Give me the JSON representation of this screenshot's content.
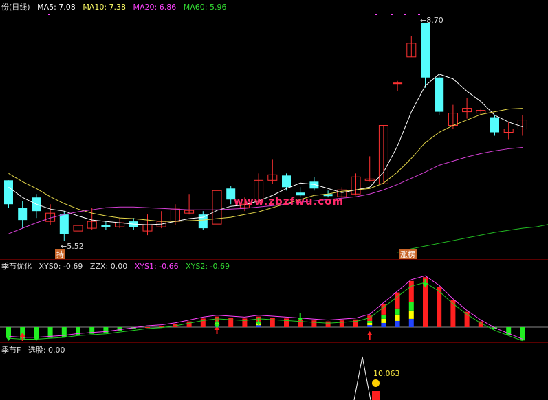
{
  "main": {
    "title_prefix": "份(日线)",
    "ma": [
      {
        "label": "MA5: 7.08",
        "color": "#ffffff"
      },
      {
        "label": "MA10: 7.38",
        "color": "#ffff66"
      },
      {
        "label": "MA20: 6.86",
        "color": "#ff44ff"
      },
      {
        "label": "MA60: 5.96",
        "color": "#33dd33"
      }
    ],
    "high_note": "8.70",
    "low_note": "5.52",
    "tag_left": "持",
    "tag_right": "涨楞",
    "watermark": "www.zbzfwu.com"
  },
  "indicator1": {
    "name": "季节优化",
    "values": [
      {
        "label": "XYS0: -0.69",
        "color": "#dddddd"
      },
      {
        "label": "ZZX: 0.00",
        "color": "#dddddd"
      },
      {
        "label": "XYS1: -0.66",
        "color": "#ff44ff"
      },
      {
        "label": "XYS2: -0.69",
        "color": "#33dd33"
      }
    ]
  },
  "indicator2": {
    "name": "季节F",
    "values": [
      {
        "label": "选股: 0.00",
        "color": "#dddddd"
      }
    ],
    "note": "10.063"
  },
  "chart_data": {
    "type": "candlestick",
    "candles": [
      {
        "o": 6.4,
        "c": 6.05,
        "h": 6.4,
        "l": 6.0
      },
      {
        "o": 6.0,
        "c": 5.82,
        "h": 6.1,
        "l": 5.7
      },
      {
        "o": 6.15,
        "c": 5.95,
        "h": 6.2,
        "l": 5.85
      },
      {
        "o": 5.8,
        "c": 5.92,
        "h": 6.05,
        "l": 5.75
      },
      {
        "o": 5.9,
        "c": 5.62,
        "h": 5.95,
        "l": 5.52
      },
      {
        "o": 5.66,
        "c": 5.74,
        "h": 5.85,
        "l": 5.6
      },
      {
        "o": 5.7,
        "c": 5.8,
        "h": 6.0,
        "l": 5.68
      },
      {
        "o": 5.75,
        "c": 5.72,
        "h": 5.8,
        "l": 5.68
      },
      {
        "o": 5.72,
        "c": 5.78,
        "h": 5.85,
        "l": 5.7
      },
      {
        "o": 5.8,
        "c": 5.72,
        "h": 5.85,
        "l": 5.68
      },
      {
        "o": 5.66,
        "c": 5.75,
        "h": 5.9,
        "l": 5.6
      },
      {
        "o": 5.72,
        "c": 5.8,
        "h": 5.95,
        "l": 5.7
      },
      {
        "o": 5.8,
        "c": 5.98,
        "h": 6.05,
        "l": 5.75
      },
      {
        "o": 5.92,
        "c": 5.96,
        "h": 6.2,
        "l": 5.9
      },
      {
        "o": 5.9,
        "c": 5.7,
        "h": 5.95,
        "l": 5.68
      },
      {
        "o": 5.76,
        "c": 6.25,
        "h": 6.3,
        "l": 5.72
      },
      {
        "o": 6.28,
        "c": 6.12,
        "h": 6.32,
        "l": 6.05
      },
      {
        "o": 6.0,
        "c": 6.05,
        "h": 6.15,
        "l": 5.95
      },
      {
        "o": 6.1,
        "c": 6.4,
        "h": 6.5,
        "l": 6.05
      },
      {
        "o": 6.4,
        "c": 6.48,
        "h": 6.7,
        "l": 6.35
      },
      {
        "o": 6.47,
        "c": 6.3,
        "h": 6.5,
        "l": 6.25
      },
      {
        "o": 6.22,
        "c": 6.18,
        "h": 6.3,
        "l": 6.15
      },
      {
        "o": 6.38,
        "c": 6.28,
        "h": 6.45,
        "l": 6.25
      },
      {
        "o": 6.2,
        "c": 6.17,
        "h": 6.25,
        "l": 6.15
      },
      {
        "o": 6.16,
        "c": 6.26,
        "h": 6.3,
        "l": 6.12
      },
      {
        "o": 6.2,
        "c": 6.45,
        "h": 6.5,
        "l": 6.18
      },
      {
        "o": 6.4,
        "c": 6.42,
        "h": 6.75,
        "l": 6.38
      },
      {
        "o": 6.35,
        "c": 7.2,
        "h": 7.2,
        "l": 6.35
      },
      {
        "o": 7.82,
        "c": 7.82,
        "h": 7.85,
        "l": 7.7
      },
      {
        "o": 8.2,
        "c": 8.4,
        "h": 8.5,
        "l": 8.2
      },
      {
        "o": 8.7,
        "c": 7.9,
        "h": 8.7,
        "l": 7.75
      },
      {
        "o": 7.9,
        "c": 7.4,
        "h": 7.95,
        "l": 7.35
      },
      {
        "o": 7.2,
        "c": 7.38,
        "h": 7.5,
        "l": 7.15
      },
      {
        "o": 7.4,
        "c": 7.45,
        "h": 7.6,
        "l": 7.3
      },
      {
        "o": 7.38,
        "c": 7.42,
        "h": 7.45,
        "l": 7.35
      },
      {
        "o": 7.32,
        "c": 7.1,
        "h": 7.35,
        "l": 7.05
      },
      {
        "o": 7.1,
        "c": 7.15,
        "h": 7.25,
        "l": 7.0
      },
      {
        "o": 7.15,
        "c": 7.28,
        "h": 7.35,
        "l": 7.05
      }
    ],
    "ma5": [
      6.3,
      6.15,
      6.05,
      5.98,
      5.95,
      5.88,
      5.82,
      5.8,
      5.78,
      5.76,
      5.75,
      5.76,
      5.8,
      5.84,
      5.86,
      5.96,
      6.02,
      6.04,
      6.1,
      6.18,
      6.28,
      6.36,
      6.34,
      6.28,
      6.22,
      6.26,
      6.3,
      6.52,
      6.9,
      7.4,
      7.78,
      7.95,
      7.88,
      7.7,
      7.55,
      7.35,
      7.25,
      7.18
    ],
    "ma10": [
      6.5,
      6.38,
      6.28,
      6.16,
      6.06,
      5.98,
      5.92,
      5.88,
      5.85,
      5.84,
      5.82,
      5.8,
      5.8,
      5.81,
      5.82,
      5.84,
      5.86,
      5.9,
      5.94,
      6.0,
      6.06,
      6.12,
      6.18,
      6.2,
      6.24,
      6.26,
      6.28,
      6.36,
      6.52,
      6.72,
      6.95,
      7.1,
      7.2,
      7.28,
      7.36,
      7.4,
      7.44,
      7.45
    ],
    "ma20": [
      5.62,
      5.7,
      5.78,
      5.85,
      5.9,
      5.94,
      5.97,
      6.0,
      6.01,
      6.01,
      6.0,
      5.99,
      5.98,
      5.97,
      5.97,
      5.97,
      5.98,
      5.99,
      6.01,
      6.03,
      6.05,
      6.08,
      6.1,
      6.12,
      6.14,
      6.16,
      6.2,
      6.26,
      6.34,
      6.43,
      6.52,
      6.62,
      6.68,
      6.74,
      6.79,
      6.83,
      6.86,
      6.88
    ],
    "ma60": [
      5.35,
      5.4,
      5.44,
      5.48,
      5.52,
      5.56,
      5.6,
      5.64,
      5.67,
      5.7,
      5.72,
      5.76
    ],
    "ma60_start": 28,
    "indicator_bars": [
      -0.55,
      -0.6,
      -0.6,
      -0.55,
      -0.5,
      -0.4,
      -0.35,
      -0.3,
      -0.2,
      -0.1,
      0.0,
      0.05,
      0.15,
      0.3,
      0.45,
      0.55,
      0.5,
      0.45,
      0.55,
      0.5,
      0.45,
      0.4,
      0.35,
      0.3,
      0.35,
      0.4,
      0.6,
      1.2,
      1.8,
      2.4,
      2.6,
      2.1,
      1.4,
      0.8,
      0.3,
      -0.1,
      -0.4,
      -0.69
    ]
  }
}
